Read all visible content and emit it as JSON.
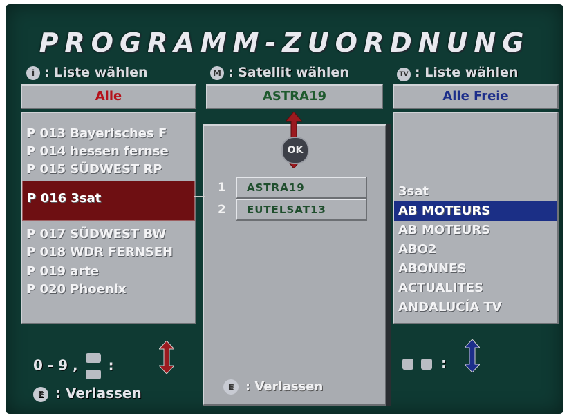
{
  "title": "PROGRAMM-ZUORDNUNG",
  "hints": {
    "left": {
      "key": "i",
      "text": ": Liste wählen"
    },
    "middle": {
      "key": "M",
      "text": ": Satellit wählen"
    },
    "right": {
      "key": "TV",
      "text": ": Liste wählen"
    }
  },
  "headers": {
    "left": "Alle",
    "middle": "ASTRA19",
    "right": "Alle Freie"
  },
  "colors": {
    "background": "#0f3a33",
    "panel": "#aeb1b6",
    "selection_left": "#6e0f12",
    "selection_right": "#1b2f86",
    "header_left_text": "#b5121b",
    "header_mid_text": "#1f5a2e",
    "header_right_text": "#1c2e8a"
  },
  "left_list": [
    {
      "label": "P 013 Bayerisches F",
      "selected": false
    },
    {
      "label": "P 014 hessen fernse",
      "selected": false
    },
    {
      "label": "P 015 SÜDWEST RP",
      "selected": false
    },
    {
      "label": "P 016 3sat",
      "selected": true
    },
    {
      "label": "P 017 SÜDWEST BW",
      "selected": false
    },
    {
      "label": "P 018 WDR FERNSEH",
      "selected": false
    },
    {
      "label": "P 019 arte",
      "selected": false
    },
    {
      "label": "P 020 Phoenix",
      "selected": false
    }
  ],
  "popup": {
    "ok_label": "OK",
    "satellites": [
      {
        "number": "1",
        "name": "ASTRA19"
      },
      {
        "number": "2",
        "name": "EUTELSAT13"
      }
    ],
    "exit": {
      "key": "E",
      "text": ": Verlassen"
    }
  },
  "right_list": [
    {
      "label": "3sat",
      "selected": false
    },
    {
      "label": "AB MOTEURS",
      "selected": true
    },
    {
      "label": "AB MOTEURS",
      "selected": false
    },
    {
      "label": "ABO2",
      "selected": false
    },
    {
      "label": "ABONNES",
      "selected": false
    },
    {
      "label": "ACTUALITES",
      "selected": false
    },
    {
      "label": "ANDALUCÍA TV",
      "selected": false
    }
  ],
  "bottom": {
    "digits": "0 - 9 ,",
    "colon": ":",
    "exit": {
      "key": "E",
      "text": ": Verlassen"
    },
    "right_colon": ":"
  },
  "icons": [
    "info-icon",
    "menu-key-icon",
    "tv-key-icon",
    "ok-button-icon",
    "up-down-arrow-icon",
    "page-up-icon",
    "page-down-icon",
    "left-right-keys-icon",
    "exit-key-icon"
  ]
}
